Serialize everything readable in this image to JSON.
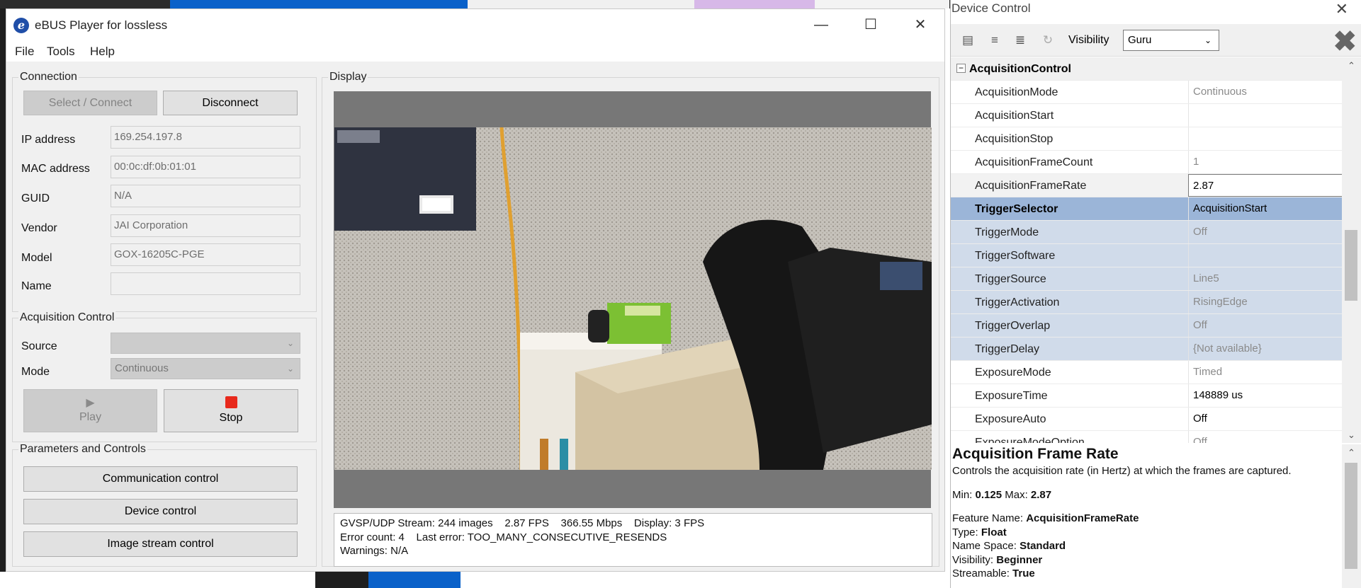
{
  "main_window": {
    "title": "eBUS Player for lossless",
    "logo_letter": "e",
    "controls": {
      "minimize": "—",
      "maximize": "☐",
      "close": "✕"
    }
  },
  "menu": [
    "File",
    "Tools",
    "Help"
  ],
  "connection": {
    "title": "Connection",
    "select_connect": "Select / Connect",
    "disconnect": "Disconnect",
    "fields": [
      {
        "label": "IP address",
        "value": "169.254.197.8"
      },
      {
        "label": "MAC address",
        "value": "00:0c:df:0b:01:01"
      },
      {
        "label": "GUID",
        "value": "N/A"
      },
      {
        "label": "Vendor",
        "value": "JAI Corporation"
      },
      {
        "label": "Model",
        "value": "GOX-16205C-PGE"
      },
      {
        "label": "Name",
        "value": ""
      }
    ]
  },
  "acquisition": {
    "title": "Acquisition Control",
    "source_label": "Source",
    "source_value": "",
    "mode_label": "Mode",
    "mode_value": "Continuous",
    "play_label": "Play",
    "stop_label": "Stop",
    "stop_color": "#e8291c"
  },
  "parameters": {
    "title": "Parameters and Controls",
    "buttons": [
      "Communication control",
      "Device control",
      "Image stream control"
    ]
  },
  "display": {
    "title": "Display",
    "stats": [
      "GVSP/UDP Stream: 244 images    2.87 FPS    366.55 Mbps    Display: 3 FPS",
      "Error count: 4    Last error: TOO_MANY_CONSECUTIVE_RESENDS",
      "Warnings: N/A"
    ]
  },
  "device_control": {
    "title": "Device Control",
    "close": "✕",
    "visibility_label": "Visibility",
    "visibility_value": "Guru",
    "category": "AcquisitionControl",
    "rows": [
      {
        "name": "AcquisitionMode",
        "value": "Continuous"
      },
      {
        "name": "AcquisitionStart",
        "value": ""
      },
      {
        "name": "AcquisitionStop",
        "value": ""
      },
      {
        "name": "AcquisitionFrameCount",
        "value": "1"
      },
      {
        "name": "AcquisitionFrameRate",
        "value": "2.87"
      },
      {
        "name": "TriggerSelector",
        "value": "AcquisitionStart"
      },
      {
        "name": "TriggerMode",
        "value": "Off"
      },
      {
        "name": "TriggerSoftware",
        "value": ""
      },
      {
        "name": "TriggerSource",
        "value": "Line5"
      },
      {
        "name": "TriggerActivation",
        "value": "RisingEdge"
      },
      {
        "name": "TriggerOverlap",
        "value": "Off"
      },
      {
        "name": "TriggerDelay",
        "value": "{Not available}"
      },
      {
        "name": "ExposureMode",
        "value": "Timed"
      },
      {
        "name": "ExposureTime",
        "value": "148889 us"
      },
      {
        "name": "ExposureAuto",
        "value": "Off"
      },
      {
        "name": "ExposureModeOption",
        "value": "Off"
      }
    ],
    "help": {
      "title": "Acquisition Frame Rate",
      "description": "Controls the acquisition rate (in Hertz) at which the frames are captured.",
      "min_label": "Min:",
      "min": "0.125",
      "max_label": "Max:",
      "max": "2.87",
      "props": [
        {
          "k": "Feature Name:",
          "v": "AcquisitionFrameRate"
        },
        {
          "k": "Type:",
          "v": "Float"
        },
        {
          "k": "Name Space:",
          "v": "Standard"
        },
        {
          "k": "Visibility:",
          "v": "Beginner"
        },
        {
          "k": "Streamable:",
          "v": "True"
        }
      ]
    }
  }
}
